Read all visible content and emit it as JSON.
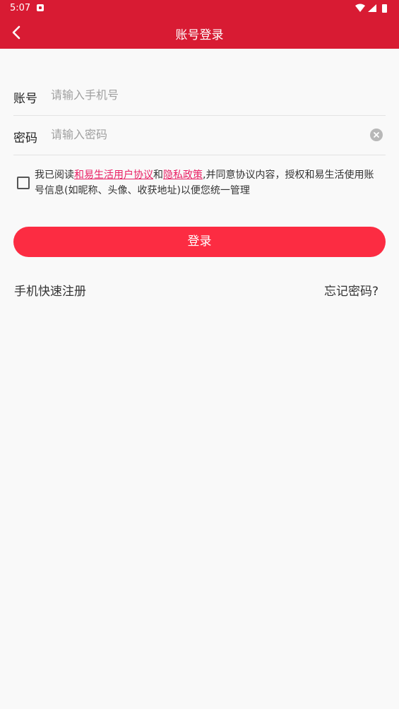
{
  "status_bar": {
    "time": "5:07"
  },
  "app_bar": {
    "title": "账号登录"
  },
  "account_field": {
    "label": "账号",
    "placeholder": "请输入手机号",
    "value": ""
  },
  "password_field": {
    "label": "密码",
    "placeholder": "请输入密码",
    "value": ""
  },
  "agreement": {
    "checked": false,
    "prefix": "我已阅读",
    "link1": "和易生活用户协议",
    "middle": "和",
    "link2": "隐私政策",
    "suffix": ",并同意协议内容，授权和易生活使用账号信息(如昵称、头像、收获地址)以便您统一管理"
  },
  "login_button": {
    "label": "登录"
  },
  "footer": {
    "register": "手机快速注册",
    "forgot": "忘记密码?"
  },
  "colors": {
    "primary": "#d81b33",
    "button": "#fc2c42",
    "link": "#e91e63"
  }
}
